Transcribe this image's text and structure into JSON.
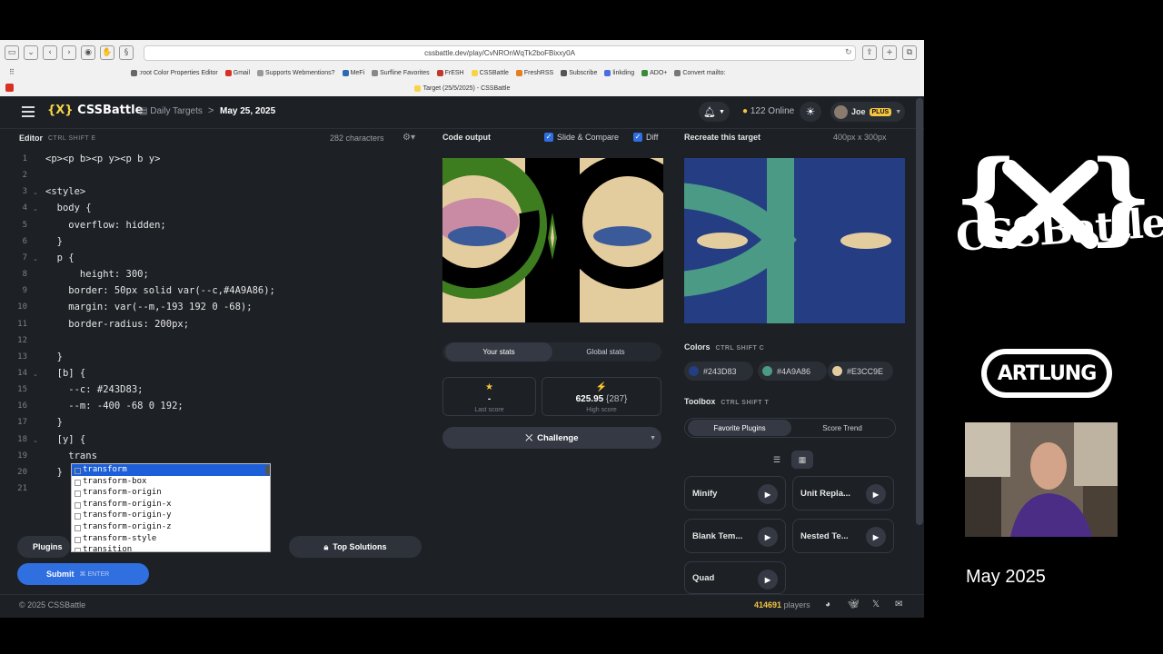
{
  "browser": {
    "url": "cssbattle.dev/play/CvNROnWqTk2boFBixxy0A",
    "bookmarks": [
      ":root Color Properties Editor",
      "Gmail",
      "Supports Webmentions?",
      "MeFi",
      "Surfline Favorites",
      "FrESH",
      "CSSBattle",
      "FreshRSS",
      "Subscribe",
      "linkding",
      "ADO+",
      "Convert mailto:"
    ],
    "tab_title": "Target (25/5/2025) - CSSBattle"
  },
  "header": {
    "logo_brand": "{X}",
    "logo_name": "CSSBattle",
    "breadcrumb_link": "Daily Targets",
    "breadcrumb_sep": ">",
    "breadcrumb_current": "May 25, 2025",
    "online_count": "122 Online",
    "user_name": "Joe",
    "plus_badge": "PLUS"
  },
  "editor": {
    "title": "Editor",
    "shortcut": "CTRL  SHIFT  E",
    "char_count": "282 characters",
    "lines": [
      {
        "n": "1",
        "text": "<p><p b><p y><p b y>"
      },
      {
        "n": "2",
        "text": ""
      },
      {
        "n": "3",
        "text": "<style>"
      },
      {
        "n": "4",
        "text": "  body {"
      },
      {
        "n": "5",
        "text": "    overflow: hidden;"
      },
      {
        "n": "6",
        "text": "  }"
      },
      {
        "n": "7",
        "text": "  p {"
      },
      {
        "n": "8",
        "text": "      height: 300;"
      },
      {
        "n": "9",
        "text": "    border: 50px solid var(--c,#4A9A86);"
      },
      {
        "n": "10",
        "text": "    margin: var(--m,-193 192 0 -68);"
      },
      {
        "n": "11",
        "text": "    border-radius: 200px;"
      },
      {
        "n": "12",
        "text": ""
      },
      {
        "n": "13",
        "text": "  }"
      },
      {
        "n": "14",
        "text": "  [b] {"
      },
      {
        "n": "15",
        "text": "    --c: #243D83;"
      },
      {
        "n": "16",
        "text": "    --m: -400 -68 0 192;"
      },
      {
        "n": "17",
        "text": "  }"
      },
      {
        "n": "18",
        "text": "  [y] {"
      },
      {
        "n": "19",
        "text": "    trans"
      },
      {
        "n": "20",
        "text": "  }"
      },
      {
        "n": "21",
        "text": ""
      }
    ],
    "autocomplete": [
      "transform",
      "transform-box",
      "transform-origin",
      "transform-origin-x",
      "transform-origin-y",
      "transform-origin-z",
      "transform-style",
      "transition"
    ],
    "autocomplete_prefix": "trans"
  },
  "bottom_bar": {
    "plugins_label": "Plugins",
    "top_solutions_label": "Top Solutions",
    "submit_label": "Submit",
    "submit_shortcut": "ENTER"
  },
  "output": {
    "title": "Code output",
    "slide_compare_label": "Slide & Compare",
    "diff_label": "Diff",
    "tab_your_stats": "Your stats",
    "tab_global_stats": "Global stats",
    "last_score_value": "-",
    "last_score_label": "Last score",
    "high_score_value": "625.95",
    "high_score_chars": "{287}",
    "high_score_label": "High score",
    "challenge_label": "Challenge"
  },
  "target": {
    "title": "Recreate this target",
    "size": "400px x 300px",
    "colors_title": "Colors",
    "colors_shortcut": "CTRL  SHIFT  C",
    "colors": [
      {
        "hex": "#243D83",
        "label": "#243D83"
      },
      {
        "hex": "#4A9A86",
        "label": "#4A9A86"
      },
      {
        "hex": "#E3CC9E",
        "label": "#E3CC9E"
      }
    ],
    "toolbox_title": "Toolbox",
    "toolbox_shortcut": "CTRL  SHIFT  T",
    "tab_favorite": "Favorite Plugins",
    "tab_score_trend": "Score Trend",
    "plugins": [
      "Minify",
      "Unit Repla...",
      "Blank Tem...",
      "Nested Te...",
      "Quad"
    ]
  },
  "footer": {
    "copyright": "© 2025 CSSBattle",
    "players_count": "414691",
    "players_label": "players"
  },
  "overlay": {
    "brand_handwritten": "CSSBattle",
    "artlung_badge": "ARTLUNG",
    "date_caption": "May 2025"
  }
}
